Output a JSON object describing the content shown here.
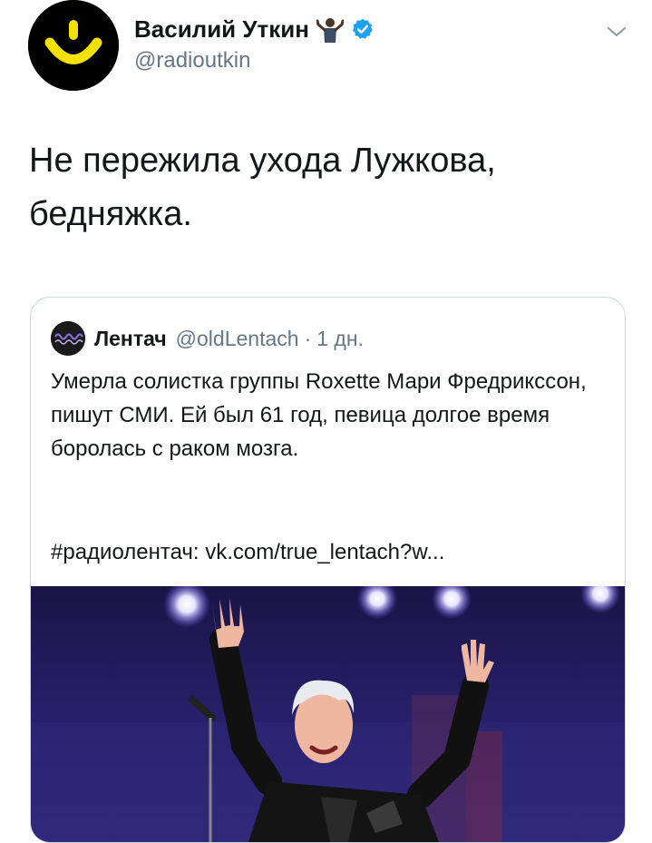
{
  "author": {
    "name": "Василий Уткин",
    "handle": "@radioutkin",
    "avatar_icon": "yellow-smiley-logo-icon",
    "emoji_icon": "person-shrugging-emoji-icon",
    "verified_icon": "verified-badge-icon"
  },
  "tweet": {
    "text": "Не пережила ухода Лужкова, бедняжка."
  },
  "menu_icon": "chevron-down-icon",
  "quoted": {
    "name": "Лентач",
    "handle": "@oldLentach",
    "separator": "·",
    "time": "1 дн.",
    "text": "Умерла солистка группы Roxette Мари Фредрикссон, пишут СМИ. Ей был 61 год, певица долгое время боролась с раком мозга.",
    "link": "#радиолентач: vk.com/true_lentach?w...",
    "photo_icon": "concert-photo"
  },
  "colors": {
    "text": "#14171a",
    "secondary": "#657786",
    "verified": "#1da1f2",
    "border": "#ccd6dd",
    "logo_yellow": "#f5e100"
  }
}
